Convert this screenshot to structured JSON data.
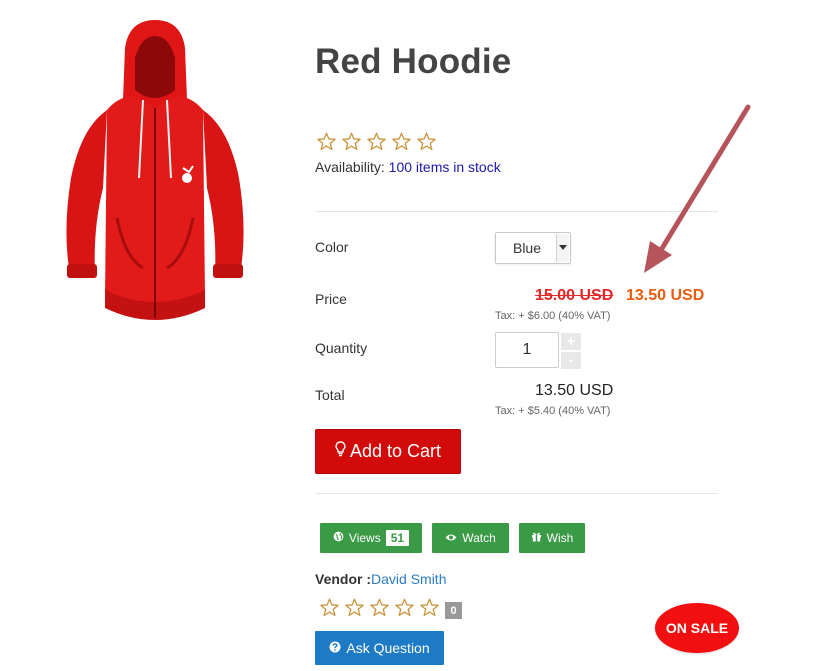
{
  "product": {
    "title": "Red Hoodie",
    "image_alt": "red hoodie",
    "rating_stars": 0,
    "availability_label": "Availability:",
    "availability_value": "100 items in stock"
  },
  "options": {
    "color_label": "Color",
    "color_value": "Blue",
    "price_label": "Price",
    "old_price": "15.00 USD",
    "new_price": "13.50 USD",
    "price_tax": "Tax: + $6.00 (40% VAT)",
    "quantity_label": "Quantity",
    "quantity_value": "1",
    "qty_plus": "+",
    "qty_minus": "-",
    "total_label": "Total",
    "total_value": "13.50 USD",
    "total_tax": "Tax: + $5.40 (40% VAT)"
  },
  "actions": {
    "add_to_cart": "Add to Cart",
    "views_label": "Views",
    "views_count": "51",
    "watch_label": "Watch",
    "wish_label": "Wish",
    "ask_question": "Ask Question"
  },
  "vendor": {
    "label": "Vendor :",
    "name": "David Smith",
    "rating_count": "0"
  },
  "badge": {
    "on_sale": "ON SALE"
  },
  "icons": {
    "add_to_cart": "lightbulb-icon",
    "views": "globe-icon",
    "watch": "eye-icon",
    "wish": "gift-icon",
    "ask": "question-circle-icon"
  },
  "colors": {
    "accent_red": "#d30a0a",
    "sale_badge": "#f20f0f",
    "old_price": "#e52828",
    "new_price": "#e85c0c",
    "green_button": "#3a9a45",
    "blue_button": "#1d7ac4",
    "star_outline": "#c9953a",
    "arrow": "#b5545a"
  }
}
